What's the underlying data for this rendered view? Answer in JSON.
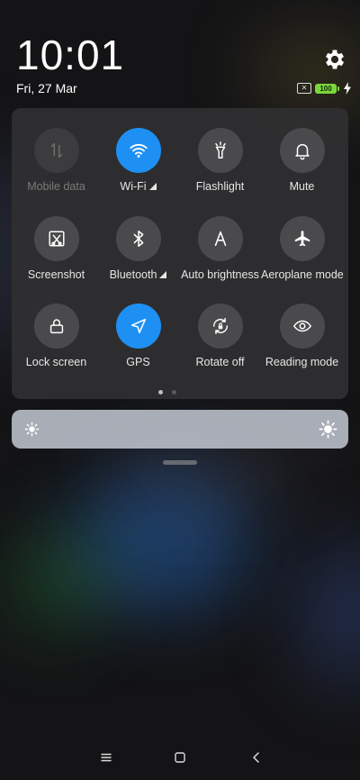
{
  "status": {
    "time": "10:01",
    "date": "Fri, 27 Mar",
    "battery_level": "100",
    "icons": [
      "settings-gear-icon",
      "no-sim-icon",
      "battery-icon",
      "charging-bolt-icon"
    ]
  },
  "quick_settings": {
    "tiles": [
      {
        "label": "Mobile data",
        "icon": "mobile-data-icon",
        "state": "disabled"
      },
      {
        "label": "Wi-Fi",
        "icon": "wifi-icon",
        "state": "on"
      },
      {
        "label": "Flashlight",
        "icon": "flashlight-icon",
        "state": "off"
      },
      {
        "label": "Mute",
        "icon": "bell-icon",
        "state": "off"
      },
      {
        "label": "Screenshot",
        "icon": "screenshot-icon",
        "state": "off"
      },
      {
        "label": "Bluetooth",
        "icon": "bluetooth-icon",
        "state": "off"
      },
      {
        "label": "Auto brightness",
        "icon": "auto-brightness-icon",
        "state": "off"
      },
      {
        "label": "Aeroplane mode",
        "icon": "airplane-icon",
        "state": "off"
      },
      {
        "label": "Lock screen",
        "icon": "lock-icon",
        "state": "off"
      },
      {
        "label": "GPS",
        "icon": "gps-icon",
        "state": "on"
      },
      {
        "label": "Rotate off",
        "icon": "rotate-lock-icon",
        "state": "off"
      },
      {
        "label": "Reading mode",
        "icon": "eye-icon",
        "state": "off"
      }
    ],
    "page_indicator": {
      "pages": 2,
      "current": 1
    }
  },
  "brightness": {
    "min_icon": "sun-small-icon",
    "max_icon": "sun-large-icon"
  },
  "navigation": {
    "buttons": [
      "menu-icon",
      "home-icon",
      "back-icon"
    ]
  },
  "colors": {
    "accent": "#1e90f3",
    "battery": "#7bd63c",
    "panel": "#303032"
  }
}
